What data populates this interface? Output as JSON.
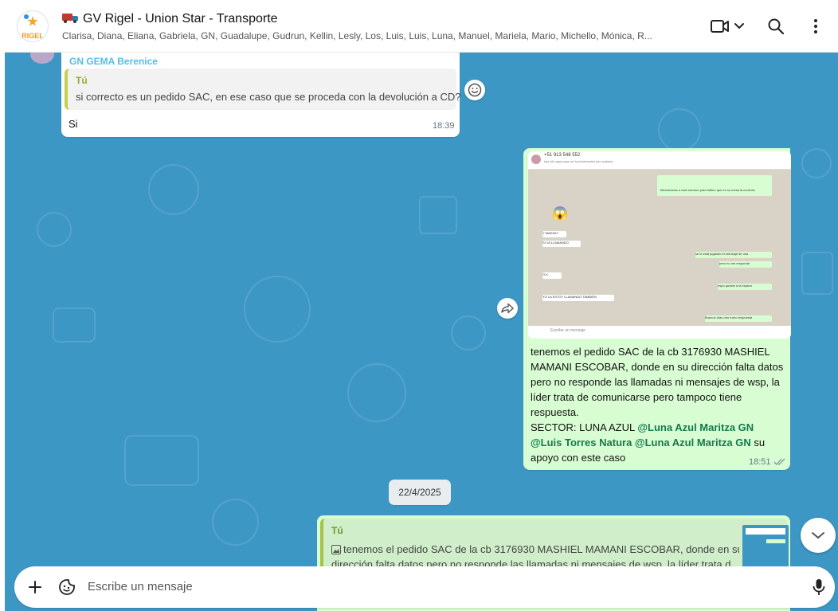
{
  "header": {
    "avatar_text": "RIGEL",
    "title": "GV Rigel - Union Star - Transporte",
    "members": "Clarisa, Diana, Eliana, Gabriela, GN, Guadalupe, Gudrun, Kellin, Lesly, Los, Luis, Luis, Luna, Manuel, Mariela, Mario, Michello, Mónica, R..."
  },
  "messages": {
    "m1": {
      "sender": "GN GEMA Berenice",
      "quote_name": "Tú",
      "quote_text": "si correcto es un pedido SAC, en ese caso que se proceda con la devolución a CD?",
      "text": "Si",
      "time": "18:39"
    },
    "m2": {
      "image": {
        "phone": "+51 913 548 552",
        "subtitle": "haz clic aquí para ver la información del contacto",
        "lines": [
          "Bienvenidos a este número para tráfico que es su mesa la correcta",
          "Y MAESA?",
          "SI YA LLAMANDO",
          "se le está jugando el mensaje de una",
          "pero no me responde",
          "O.K.",
          "espo queste a la espera",
          "YO LA ESTOY LLAMANDO TAMBIEN",
          "Buenos días otro turno respuesta",
          "Escribe un mensaje"
        ]
      },
      "text_1": "tenemos el pedido SAC de la cb 3176930 MASHIEL MAMANI ESCOBAR, donde en su dirección falta datos pero no responde las llamadas ni mensajes de wsp, la líder trata de comunicarse pero tampoco tiene respuesta.",
      "sector_label": "SECTOR: LUNA AZUL ",
      "mention_1": "@Luna Azul Maritza GN",
      "mention_2": "@Luis Torres Natura",
      "mention_3": "@Luna Azul Maritza GN",
      "text_2": " su apoyo con este caso",
      "time": "18:51"
    },
    "date_chip": "22/4/2025",
    "m3": {
      "quote_name": "Tú",
      "quote_text_1": "tenemos el pedido SAC de la cb 3176930 MASHIEL MAMANI ESCOBAR, donde en su",
      "quote_text_2": "dirección falta datos pero no responde las llamadas ni mensajes de wsp. la líder trata d..."
    }
  },
  "composer": {
    "placeholder": "Escribe un mensaje"
  },
  "icons": {
    "video": "video-camera-icon",
    "search": "search-icon",
    "menu": "kebab-menu-icon",
    "plus": "plus-icon",
    "sticker": "sticker-icon",
    "mic": "microphone-icon"
  },
  "colors": {
    "chat_bg": "#3d97c4",
    "outgoing": "#d9fdd3",
    "incoming": "#ffffff",
    "mention": "#127a4c"
  }
}
